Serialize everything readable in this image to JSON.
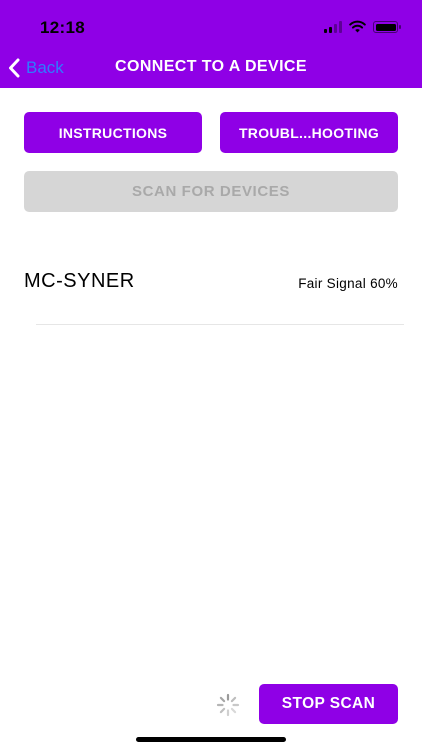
{
  "status_bar": {
    "time": "12:18",
    "icons": [
      "cellular-signal-icon",
      "wifi-icon",
      "battery-icon"
    ]
  },
  "nav": {
    "back_label": "Back",
    "title": "CONNECT TO A DEVICE"
  },
  "actions": {
    "instructions_label": "INSTRUCTIONS",
    "troubleshooting_label": "TROUBL...HOOTING",
    "scan_label": "SCAN FOR DEVICES",
    "scan_enabled": false
  },
  "devices": [
    {
      "name": "MC-SYNER",
      "signal": "Fair Signal 60%"
    }
  ],
  "footer": {
    "stop_scan_label": "STOP SCAN",
    "scanning": true
  },
  "colors": {
    "accent": "#8f00e6",
    "link": "#2f7bff",
    "disabled_bg": "#d6d6d6",
    "disabled_text": "#a9a9a9"
  }
}
